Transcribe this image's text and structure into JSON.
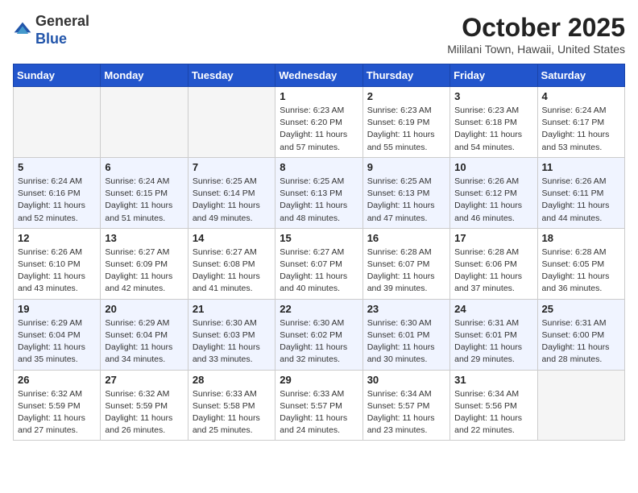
{
  "header": {
    "logo_general": "General",
    "logo_blue": "Blue",
    "month": "October 2025",
    "location": "Mililani Town, Hawaii, United States"
  },
  "weekdays": [
    "Sunday",
    "Monday",
    "Tuesday",
    "Wednesday",
    "Thursday",
    "Friday",
    "Saturday"
  ],
  "weeks": [
    [
      {
        "day": "",
        "sunrise": "",
        "sunset": "",
        "daylight": ""
      },
      {
        "day": "",
        "sunrise": "",
        "sunset": "",
        "daylight": ""
      },
      {
        "day": "",
        "sunrise": "",
        "sunset": "",
        "daylight": ""
      },
      {
        "day": "1",
        "sunrise": "Sunrise: 6:23 AM",
        "sunset": "Sunset: 6:20 PM",
        "daylight": "Daylight: 11 hours and 57 minutes."
      },
      {
        "day": "2",
        "sunrise": "Sunrise: 6:23 AM",
        "sunset": "Sunset: 6:19 PM",
        "daylight": "Daylight: 11 hours and 55 minutes."
      },
      {
        "day": "3",
        "sunrise": "Sunrise: 6:23 AM",
        "sunset": "Sunset: 6:18 PM",
        "daylight": "Daylight: 11 hours and 54 minutes."
      },
      {
        "day": "4",
        "sunrise": "Sunrise: 6:24 AM",
        "sunset": "Sunset: 6:17 PM",
        "daylight": "Daylight: 11 hours and 53 minutes."
      }
    ],
    [
      {
        "day": "5",
        "sunrise": "Sunrise: 6:24 AM",
        "sunset": "Sunset: 6:16 PM",
        "daylight": "Daylight: 11 hours and 52 minutes."
      },
      {
        "day": "6",
        "sunrise": "Sunrise: 6:24 AM",
        "sunset": "Sunset: 6:15 PM",
        "daylight": "Daylight: 11 hours and 51 minutes."
      },
      {
        "day": "7",
        "sunrise": "Sunrise: 6:25 AM",
        "sunset": "Sunset: 6:14 PM",
        "daylight": "Daylight: 11 hours and 49 minutes."
      },
      {
        "day": "8",
        "sunrise": "Sunrise: 6:25 AM",
        "sunset": "Sunset: 6:13 PM",
        "daylight": "Daylight: 11 hours and 48 minutes."
      },
      {
        "day": "9",
        "sunrise": "Sunrise: 6:25 AM",
        "sunset": "Sunset: 6:13 PM",
        "daylight": "Daylight: 11 hours and 47 minutes."
      },
      {
        "day": "10",
        "sunrise": "Sunrise: 6:26 AM",
        "sunset": "Sunset: 6:12 PM",
        "daylight": "Daylight: 11 hours and 46 minutes."
      },
      {
        "day": "11",
        "sunrise": "Sunrise: 6:26 AM",
        "sunset": "Sunset: 6:11 PM",
        "daylight": "Daylight: 11 hours and 44 minutes."
      }
    ],
    [
      {
        "day": "12",
        "sunrise": "Sunrise: 6:26 AM",
        "sunset": "Sunset: 6:10 PM",
        "daylight": "Daylight: 11 hours and 43 minutes."
      },
      {
        "day": "13",
        "sunrise": "Sunrise: 6:27 AM",
        "sunset": "Sunset: 6:09 PM",
        "daylight": "Daylight: 11 hours and 42 minutes."
      },
      {
        "day": "14",
        "sunrise": "Sunrise: 6:27 AM",
        "sunset": "Sunset: 6:08 PM",
        "daylight": "Daylight: 11 hours and 41 minutes."
      },
      {
        "day": "15",
        "sunrise": "Sunrise: 6:27 AM",
        "sunset": "Sunset: 6:07 PM",
        "daylight": "Daylight: 11 hours and 40 minutes."
      },
      {
        "day": "16",
        "sunrise": "Sunrise: 6:28 AM",
        "sunset": "Sunset: 6:07 PM",
        "daylight": "Daylight: 11 hours and 39 minutes."
      },
      {
        "day": "17",
        "sunrise": "Sunrise: 6:28 AM",
        "sunset": "Sunset: 6:06 PM",
        "daylight": "Daylight: 11 hours and 37 minutes."
      },
      {
        "day": "18",
        "sunrise": "Sunrise: 6:28 AM",
        "sunset": "Sunset: 6:05 PM",
        "daylight": "Daylight: 11 hours and 36 minutes."
      }
    ],
    [
      {
        "day": "19",
        "sunrise": "Sunrise: 6:29 AM",
        "sunset": "Sunset: 6:04 PM",
        "daylight": "Daylight: 11 hours and 35 minutes."
      },
      {
        "day": "20",
        "sunrise": "Sunrise: 6:29 AM",
        "sunset": "Sunset: 6:04 PM",
        "daylight": "Daylight: 11 hours and 34 minutes."
      },
      {
        "day": "21",
        "sunrise": "Sunrise: 6:30 AM",
        "sunset": "Sunset: 6:03 PM",
        "daylight": "Daylight: 11 hours and 33 minutes."
      },
      {
        "day": "22",
        "sunrise": "Sunrise: 6:30 AM",
        "sunset": "Sunset: 6:02 PM",
        "daylight": "Daylight: 11 hours and 32 minutes."
      },
      {
        "day": "23",
        "sunrise": "Sunrise: 6:30 AM",
        "sunset": "Sunset: 6:01 PM",
        "daylight": "Daylight: 11 hours and 30 minutes."
      },
      {
        "day": "24",
        "sunrise": "Sunrise: 6:31 AM",
        "sunset": "Sunset: 6:01 PM",
        "daylight": "Daylight: 11 hours and 29 minutes."
      },
      {
        "day": "25",
        "sunrise": "Sunrise: 6:31 AM",
        "sunset": "Sunset: 6:00 PM",
        "daylight": "Daylight: 11 hours and 28 minutes."
      }
    ],
    [
      {
        "day": "26",
        "sunrise": "Sunrise: 6:32 AM",
        "sunset": "Sunset: 5:59 PM",
        "daylight": "Daylight: 11 hours and 27 minutes."
      },
      {
        "day": "27",
        "sunrise": "Sunrise: 6:32 AM",
        "sunset": "Sunset: 5:59 PM",
        "daylight": "Daylight: 11 hours and 26 minutes."
      },
      {
        "day": "28",
        "sunrise": "Sunrise: 6:33 AM",
        "sunset": "Sunset: 5:58 PM",
        "daylight": "Daylight: 11 hours and 25 minutes."
      },
      {
        "day": "29",
        "sunrise": "Sunrise: 6:33 AM",
        "sunset": "Sunset: 5:57 PM",
        "daylight": "Daylight: 11 hours and 24 minutes."
      },
      {
        "day": "30",
        "sunrise": "Sunrise: 6:34 AM",
        "sunset": "Sunset: 5:57 PM",
        "daylight": "Daylight: 11 hours and 23 minutes."
      },
      {
        "day": "31",
        "sunrise": "Sunrise: 6:34 AM",
        "sunset": "Sunset: 5:56 PM",
        "daylight": "Daylight: 11 hours and 22 minutes."
      },
      {
        "day": "",
        "sunrise": "",
        "sunset": "",
        "daylight": ""
      }
    ]
  ]
}
